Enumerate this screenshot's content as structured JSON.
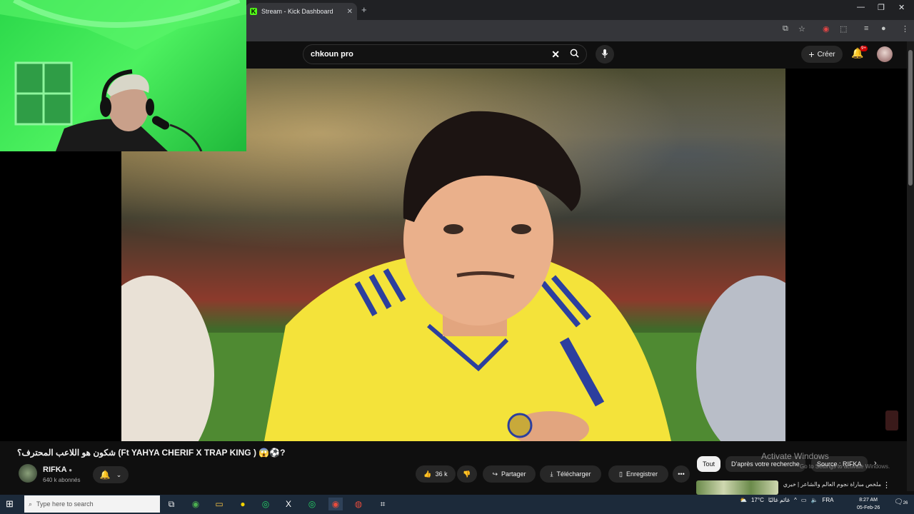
{
  "browser": {
    "tab_title": "Stream - Kick Dashboard",
    "new_tab": "+",
    "window_controls": [
      "—",
      "❐",
      "✕"
    ]
  },
  "youtube": {
    "search_value": "chkoun pro",
    "create_label": "Créer",
    "notification_count": "9+",
    "video_title": "شكون هو اللاعب المحترف؟ (Ft YAHYA CHERIF X TRAP KING ) 😱⚽?",
    "channel_name": "RIFKA",
    "subscribers": "640 k abonnés",
    "likes": "36 k",
    "share_label": "Partager",
    "download_label": "Télécharger",
    "save_label": "Enregistrer",
    "more_label": "•••",
    "chips": [
      "Tout",
      "D'après votre recherche",
      "Source : RIFKA"
    ],
    "suggestion_title": "ملخص مباراة نجوم العالم والشاعر | خيري"
  },
  "watermark": {
    "line1": "Activate Windows",
    "line2": "Go to Settings to activate Windows."
  },
  "taskbar": {
    "search_placeholder": "Type here to search",
    "weather": "17°C",
    "weather_desc": "غائم غالبًا",
    "language": "FRA",
    "time": "8:27 AM",
    "date": "05-Feb-26",
    "notif_count": "26"
  }
}
